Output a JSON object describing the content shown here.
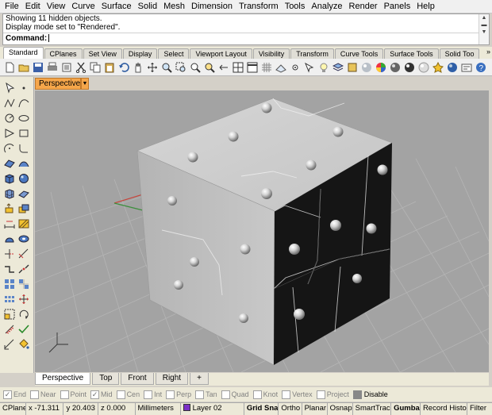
{
  "menu": [
    "File",
    "Edit",
    "View",
    "Curve",
    "Surface",
    "Solid",
    "Mesh",
    "Dimension",
    "Transform",
    "Tools",
    "Analyze",
    "Render",
    "Panels",
    "Help"
  ],
  "command_history": [
    "Showing 11 hidden objects.",
    "Display mode set to \"Rendered\"."
  ],
  "command_prompt": "Command:",
  "toolbar_tabs": [
    "Standard",
    "CPlanes",
    "Set View",
    "Display",
    "Select",
    "Viewport Layout",
    "Visibility",
    "Transform",
    "Curve Tools",
    "Surface Tools",
    "Solid Too"
  ],
  "toolbar_tab_nav": "»",
  "active_viewport": "Perspective",
  "axis_colors": {
    "x": "#c8433a",
    "y": "#3c8f3c"
  },
  "viewport_tabs": [
    "Perspective",
    "Top",
    "Front",
    "Right"
  ],
  "add_viewport_tab": "+",
  "osnap": [
    {
      "label": "End",
      "checked": true
    },
    {
      "label": "Near",
      "checked": false
    },
    {
      "label": "Point",
      "checked": false
    },
    {
      "label": "Mid",
      "checked": true
    },
    {
      "label": "Cen",
      "checked": false
    },
    {
      "label": "Int",
      "checked": false
    },
    {
      "label": "Perp",
      "checked": false
    },
    {
      "label": "Tan",
      "checked": false
    },
    {
      "label": "Quad",
      "checked": false
    },
    {
      "label": "Knot",
      "checked": false
    },
    {
      "label": "Vertex",
      "checked": false
    },
    {
      "label": "Project",
      "checked": false
    }
  ],
  "osnap_disable": "Disable",
  "status": {
    "cplane": "CPlane",
    "x": "x -71.311",
    "y": "y 20.403",
    "z": "z 0.000",
    "units": "Millimeters",
    "layer": "Layer 02",
    "layer_color": "#7b2fc8",
    "grid_snap": "Grid Snap",
    "ortho": "Ortho",
    "planar": "Planar",
    "osnap": "Osnap",
    "smarttrack": "SmartTrack",
    "gumball": "Gumball",
    "record_history": "Record History",
    "filter": "Filter"
  }
}
